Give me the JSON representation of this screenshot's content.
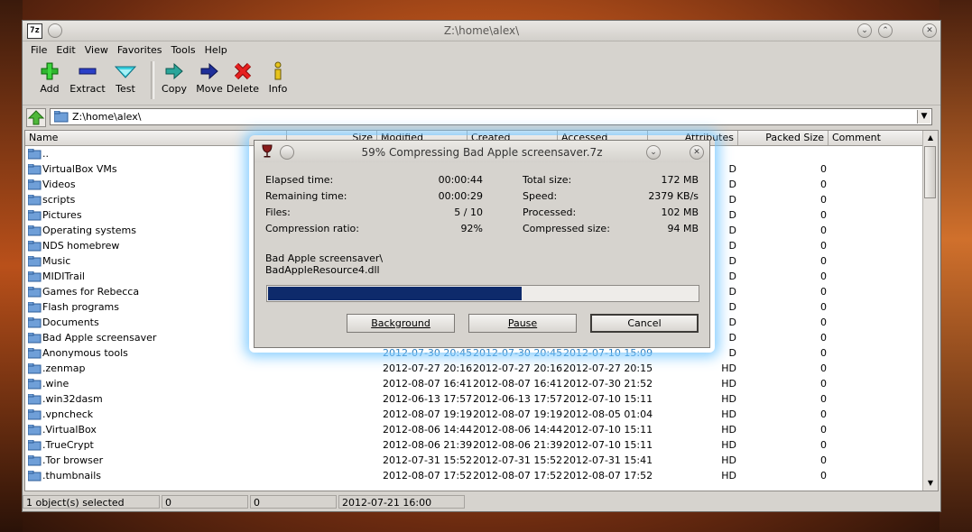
{
  "window": {
    "title": "Z:\\home\\alex\\",
    "app_icon": "7z"
  },
  "menu": [
    "File",
    "Edit",
    "View",
    "Favorites",
    "Tools",
    "Help"
  ],
  "toolbar": {
    "add": {
      "label": "Add",
      "icon": "green-plus-icon"
    },
    "extract": {
      "label": "Extract",
      "icon": "blue-minus-icon"
    },
    "test": {
      "label": "Test",
      "icon": "cyan-check-icon"
    },
    "copy": {
      "label": "Copy",
      "icon": "teal-arrow-right-icon"
    },
    "move": {
      "label": "Move",
      "icon": "navy-arrow-right-icon"
    },
    "delete": {
      "label": "Delete",
      "icon": "red-x-icon"
    },
    "info": {
      "label": "Info",
      "icon": "info-icon"
    }
  },
  "address": {
    "value": "Z:\\home\\alex\\"
  },
  "columns": [
    "Name",
    "Size",
    "Modified",
    "Created",
    "Accessed",
    "Attributes",
    "Packed Size",
    "Comment"
  ],
  "rows": [
    {
      "name": "..",
      "modified": "",
      "created": "",
      "accessed": "",
      "attr": "",
      "packed": ""
    },
    {
      "name": "VirtualBox VMs",
      "modified": "",
      "created": "",
      "accessed": "",
      "attr": "D",
      "packed": "0"
    },
    {
      "name": "Videos",
      "modified": "",
      "created": "",
      "accessed": "",
      "attr": "D",
      "packed": "0"
    },
    {
      "name": "scripts",
      "modified": "",
      "created": "",
      "accessed": "",
      "attr": "D",
      "packed": "0"
    },
    {
      "name": "Pictures",
      "modified": "",
      "created": "",
      "accessed": "",
      "attr": "D",
      "packed": "0"
    },
    {
      "name": "Operating systems",
      "modified": "",
      "created": "",
      "accessed": "",
      "attr": "D",
      "packed": "0"
    },
    {
      "name": "NDS homebrew",
      "modified": "",
      "created": "",
      "accessed": "",
      "attr": "D",
      "packed": "0"
    },
    {
      "name": "Music",
      "modified": "",
      "created": "",
      "accessed": "",
      "attr": "D",
      "packed": "0"
    },
    {
      "name": "MIDITrail",
      "modified": "",
      "created": "",
      "accessed": "",
      "attr": "D",
      "packed": "0"
    },
    {
      "name": "Games for Rebecca",
      "modified": "",
      "created": "",
      "accessed": "",
      "attr": "D",
      "packed": "0"
    },
    {
      "name": "Flash programs",
      "modified": "",
      "created": "",
      "accessed": "",
      "attr": "D",
      "packed": "0"
    },
    {
      "name": "Documents",
      "modified": "",
      "created": "",
      "accessed": "",
      "attr": "D",
      "packed": "0"
    },
    {
      "name": "Bad Apple screensaver",
      "modified": "",
      "created": "",
      "accessed": "",
      "attr": "D",
      "packed": "0"
    },
    {
      "name": "Anonymous tools",
      "modified": "2012-07-30 20:45",
      "created": "2012-07-30 20:45",
      "accessed": "2012-07-10 15:09",
      "attr": "D",
      "packed": "0",
      "faded": true
    },
    {
      "name": ".zenmap",
      "modified": "2012-07-27 20:16",
      "created": "2012-07-27 20:16",
      "accessed": "2012-07-27 20:15",
      "attr": "HD",
      "packed": "0"
    },
    {
      "name": ".wine",
      "modified": "2012-08-07 16:41",
      "created": "2012-08-07 16:41",
      "accessed": "2012-07-30 21:52",
      "attr": "HD",
      "packed": "0"
    },
    {
      "name": ".win32dasm",
      "modified": "2012-06-13 17:57",
      "created": "2012-06-13 17:57",
      "accessed": "2012-07-10 15:11",
      "attr": "HD",
      "packed": "0"
    },
    {
      "name": ".vpncheck",
      "modified": "2012-08-07 19:19",
      "created": "2012-08-07 19:19",
      "accessed": "2012-08-05 01:04",
      "attr": "HD",
      "packed": "0"
    },
    {
      "name": ".VirtualBox",
      "modified": "2012-08-06 14:44",
      "created": "2012-08-06 14:44",
      "accessed": "2012-07-10 15:11",
      "attr": "HD",
      "packed": "0"
    },
    {
      "name": ".TrueCrypt",
      "modified": "2012-08-06 21:39",
      "created": "2012-08-06 21:39",
      "accessed": "2012-07-10 15:11",
      "attr": "HD",
      "packed": "0"
    },
    {
      "name": ".Tor browser",
      "modified": "2012-07-31 15:52",
      "created": "2012-07-31 15:52",
      "accessed": "2012-07-31 15:41",
      "attr": "HD",
      "packed": "0"
    },
    {
      "name": ".thumbnails",
      "modified": "2012-08-07 17:52",
      "created": "2012-08-07 17:52",
      "accessed": "2012-08-07 17:52",
      "attr": "HD",
      "packed": "0"
    }
  ],
  "status": {
    "selected": "1 object(s) selected",
    "size1": "0",
    "size2": "0",
    "date": "2012-07-21 16:00"
  },
  "dialog": {
    "title": "59% Compressing Bad Apple screensaver.7z",
    "progress": 0.59,
    "left": [
      {
        "k": "Elapsed time:",
        "v": "00:00:44"
      },
      {
        "k": "Remaining time:",
        "v": "00:00:29"
      },
      {
        "k": "Files:",
        "v": "5 / 10"
      },
      {
        "k": "Compression ratio:",
        "v": "92%"
      }
    ],
    "right": [
      {
        "k": "Total size:",
        "v": "172 MB"
      },
      {
        "k": "Speed:",
        "v": "2379 KB/s"
      },
      {
        "k": "Processed:",
        "v": "102 MB"
      },
      {
        "k": "Compressed size:",
        "v": "94 MB"
      }
    ],
    "path_line1": "Bad Apple screensaver\\",
    "path_line2": "BadAppleResource4.dll",
    "buttons": {
      "background": "Background",
      "pause": "Pause",
      "cancel": "Cancel"
    }
  },
  "colors": {
    "faded_text": "#2f7fbf",
    "progress_fill": "#0e2a6b",
    "folder": "#5b8fcf"
  }
}
